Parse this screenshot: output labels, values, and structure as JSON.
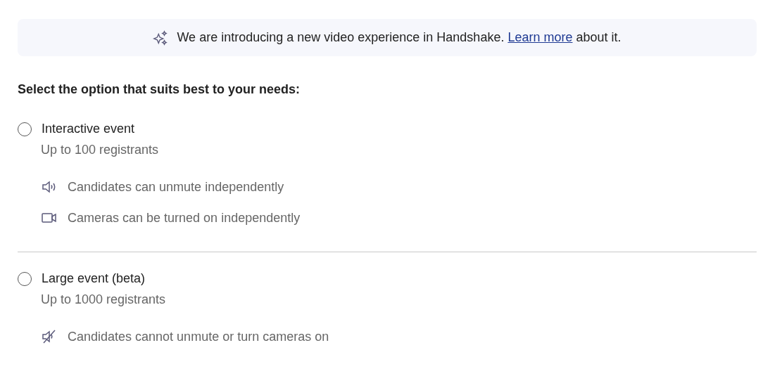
{
  "banner": {
    "text_before": "We are introducing a new video experience in Handshake.",
    "link": "Learn more",
    "text_after": "about it."
  },
  "heading": "Select the option that suits best to your needs:",
  "options": [
    {
      "title": "Interactive event",
      "selected": false,
      "subtitle": "Up to 100 registrants",
      "features": [
        {
          "kind": "speaker",
          "text": "Candidates can unmute independently"
        },
        {
          "kind": "camera",
          "text": "Cameras can be turned on independently"
        }
      ]
    },
    {
      "title": "Large event (beta)",
      "selected": false,
      "subtitle": "Up to 1000 registrants",
      "features": [
        {
          "kind": "muted",
          "text": "Candidates cannot unmute or turn cameras on"
        }
      ]
    }
  ]
}
